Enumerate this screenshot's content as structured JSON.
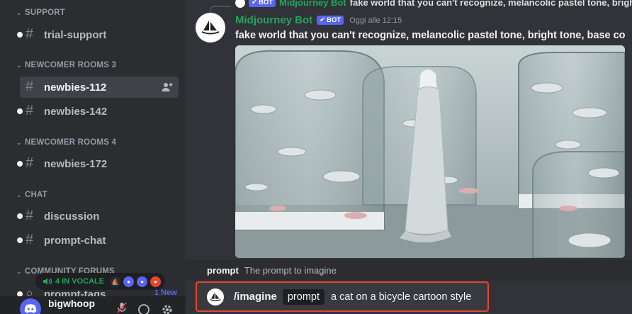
{
  "sidebar": {
    "categories": [
      {
        "label": "SUPPORT"
      },
      {
        "label": "NEWCOMER ROOMS 3"
      },
      {
        "label": "NEWCOMER ROOMS 4"
      },
      {
        "label": "CHAT"
      },
      {
        "label": "COMMUNITY FORUMS"
      }
    ],
    "channels": [
      {
        "label": "trial-support",
        "icon": "hash-icon"
      },
      {
        "label": "newbies-112",
        "icon": "thread-hash-icon",
        "active": true
      },
      {
        "label": "newbies-142",
        "icon": "thread-hash-icon"
      },
      {
        "label": "newbies-172",
        "icon": "thread-hash-icon"
      },
      {
        "label": "discussion",
        "icon": "hash-icon"
      },
      {
        "label": "prompt-chat",
        "icon": "hash-icon"
      },
      {
        "label": "prompt-tags",
        "icon": "forum-icon"
      }
    ],
    "voice": {
      "label": "4 IN VOCALE"
    },
    "new_badge": "1 New",
    "user": {
      "name": "bigwhoop"
    }
  },
  "message": {
    "reply": {
      "bot_tag": "BOT",
      "author": "Midjourney Bot",
      "text": "fake world that you can't recognize, melancolic pastel tone, bright"
    },
    "author": "Midjourney Bot",
    "bot_tag": "BOT",
    "timestamp": "Oggi alle 12:15",
    "text": "fake world that you can't recognize, melancolic pastel tone, bright tone, base co"
  },
  "command_hint": {
    "name": "prompt",
    "description": "The prompt to imagine"
  },
  "composer": {
    "command": "/imagine",
    "option": "prompt",
    "value": "a cat on a bicycle cartoon style"
  },
  "colors": {
    "accent": "#5865f2",
    "online_green": "#23a55a",
    "highlight_border": "#e8452c"
  }
}
